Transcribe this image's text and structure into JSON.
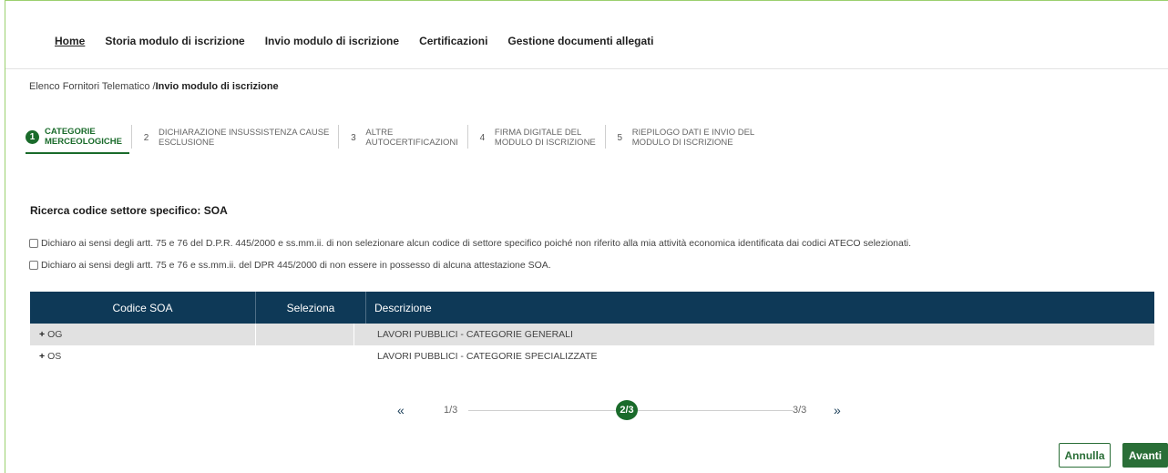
{
  "nav": {
    "items": [
      {
        "label": "Home",
        "active": true
      },
      {
        "label": "Storia modulo di iscrizione",
        "active": false
      },
      {
        "label": "Invio modulo di iscrizione",
        "active": false
      },
      {
        "label": "Certificazioni",
        "active": false
      },
      {
        "label": "Gestione documenti allegati",
        "active": false
      }
    ]
  },
  "breadcrumb": {
    "parent": "Elenco Fornitori Telematico /",
    "current": "Invio modulo di iscrizione"
  },
  "steps": [
    {
      "num": "1",
      "line1": "CATEGORIE",
      "line2": "MERCEOLOGICHE"
    },
    {
      "num": "2",
      "line1": "DICHIARAZIONE INSUSSISTENZA CAUSE",
      "line2": "ESCLUSIONE"
    },
    {
      "num": "3",
      "line1": "ALTRE",
      "line2": "AUTOCERTIFICAZIONI"
    },
    {
      "num": "4",
      "line1": "FIRMA DIGITALE DEL",
      "line2": "MODULO DI ISCRIZIONE"
    },
    {
      "num": "5",
      "line1": "RIEPILOGO DATI E INVIO DEL",
      "line2": "MODULO DI ISCRIZIONE"
    }
  ],
  "section_title": "Ricerca codice settore specifico: SOA",
  "checks": [
    "Dichiaro ai sensi degli artt. 75 e 76 del D.P.R. 445/2000 e ss.mm.ii. di non selezionare alcun codice di settore specifico poiché non riferito alla mia attività economica identificata dai codici ATECO selezionati.",
    "Dichiaro ai sensi degli artt. 75 e 76 e ss.mm.ii. del DPR 445/2000 di non essere in possesso di alcuna attestazione SOA."
  ],
  "table": {
    "headers": [
      "Codice SOA",
      "Seleziona",
      "Descrizione"
    ],
    "rows": [
      {
        "expand": "+",
        "code": "OG",
        "desc": "LAVORI PUBBLICI - CATEGORIE GENERALI"
      },
      {
        "expand": "+",
        "code": "OS",
        "desc": "LAVORI PUBBLICI - CATEGORIE SPECIALIZZATE"
      }
    ]
  },
  "pager": {
    "first": "«",
    "last": "»",
    "p1": "1/3",
    "p2": "2/3",
    "p3": "3/3"
  },
  "buttons": {
    "cancel": "Annulla",
    "next": "Avanti"
  },
  "colors": {
    "accent": "#1a6b2b",
    "header": "#0e3957",
    "frame": "#9bd06f"
  }
}
